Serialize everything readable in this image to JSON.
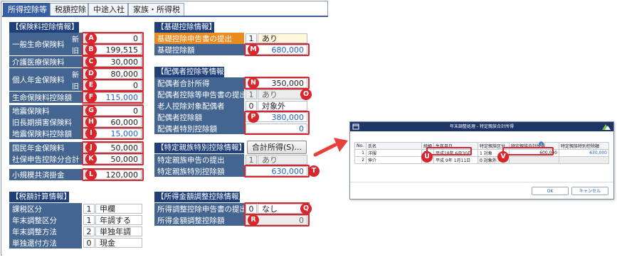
{
  "tabs": [
    "所得控除等",
    "税額控除",
    "中途入社",
    "家族・所得税"
  ],
  "insurance": {
    "header": "【保険料控除情報】",
    "general_life": "一般生命保険料",
    "new": "新",
    "old": "旧",
    "general_life_new": "0",
    "general_life_old": "199,515",
    "care_medical": "介護医療保険料",
    "care_medical_val": "30,000",
    "pension": "個人年金保険料",
    "pension_new": "80,000",
    "pension_old": "0",
    "life_deduction": "生命保険料控除額",
    "life_deduction_val": "115,000",
    "earthquake": "地震保険料",
    "earthquake_val": "0",
    "old_longterm": "旧長期損害保険料",
    "old_longterm_val": "60,000",
    "earthquake_deduction": "地震保険料控除額",
    "earthquake_deduction_val": "15,000",
    "national_pension": "国民年金保険料",
    "national_pension_val": "50,000",
    "social_total": "社保申告控除分合計",
    "social_total_val": "50,000",
    "small_business": "小規模共済掛金",
    "small_business_val": "120,000"
  },
  "tax_calc": {
    "header": "【税額計算情報】",
    "rows": [
      {
        "label": "課税区分",
        "code": "1",
        "text": "甲欄"
      },
      {
        "label": "年末調整区分",
        "code": "1",
        "text": "年調する"
      },
      {
        "label": "年末調整方法",
        "code": "2",
        "text": "単独年調"
      },
      {
        "label": "単独還付方法",
        "code": "0",
        "text": "現金"
      }
    ]
  },
  "basic": {
    "header": "【基礎控除情報】",
    "submit_label": "基礎控除申告書の提出",
    "submit_code": "1",
    "submit_text": "あり",
    "amount_label": "基礎控除額",
    "amount_val": "680,000"
  },
  "spouse": {
    "header": "【配偶者控除等情報】",
    "income_label": "配偶者合計所得",
    "income_val": "350,000",
    "submit_label": "配偶者控除等申告書の提出",
    "submit_code": "1",
    "submit_text": "あり",
    "elderly_label": "老人控除対象配偶者",
    "elderly_code": "0",
    "elderly_text": "対象外",
    "deduction_label": "配偶者控除額",
    "deduction_val": "380,000",
    "special_label": "配偶者特別控除額",
    "special_val": "0"
  },
  "special_relative": {
    "header": "【特定親族特別控除情報】",
    "button": "合計所得(S)...",
    "submit_label": "特定親族申告の提出",
    "submit_code": "1",
    "submit_text": "あり",
    "amount_label": "特定親族特別控除額",
    "amount_val": "630,000"
  },
  "income_adjust": {
    "header": "【所得金額調整控除情報】",
    "submit_label": "所得調整控除申告書の提出",
    "submit_code": "0",
    "submit_text": "なし",
    "amount_label": "所得金額調整控除額",
    "amount_val": "0"
  },
  "badges": {
    "A": "A",
    "B": "B",
    "C": "C",
    "D": "D",
    "E": "E",
    "F": "F",
    "G": "G",
    "H": "H",
    "I": "I",
    "J": "J",
    "K": "K",
    "L": "L",
    "M": "M",
    "N": "N",
    "O": "O",
    "P": "P",
    "Q": "Q",
    "R": "R",
    "T": "T",
    "U": "U",
    "V": "V"
  },
  "dialog": {
    "title": "年末調整処理 - 特定親族合計所得",
    "headers": [
      "No.",
      "氏名",
      "続柄",
      "生年月日",
      "特定親族区分",
      "特定親族合計所得",
      "特定親族特別控除額"
    ],
    "rows": [
      {
        "no": "1",
        "name": "洋服",
        "rel": "子",
        "birth": "平成18年 6月30日",
        "code": "1",
        "kbn": "対象",
        "income": "600,000",
        "deduction": "630,000"
      },
      {
        "no": "2",
        "name": "伸介",
        "rel": "子",
        "birth": "平成 9年 1月11日",
        "code": "0",
        "kbn": "対象外",
        "income": "",
        "deduction": ""
      }
    ],
    "ok": "OK",
    "cancel": "キャンセル"
  },
  "colors": {
    "accent": "#d9262c",
    "header": "#1f3f7a",
    "label": "#44658f",
    "value_blue": "#1f5fcc",
    "arrow": "#e8403a"
  }
}
